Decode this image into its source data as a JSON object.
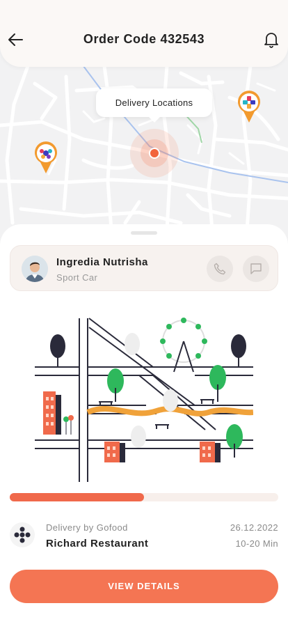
{
  "header": {
    "title": "Order Code 432543",
    "back_icon": "arrow-left-icon",
    "notification_icon": "bell-icon"
  },
  "map": {
    "tooltip": "Delivery Locations"
  },
  "driver": {
    "name": "Ingredia Nutrisha",
    "vehicle": "Sport Car",
    "call_icon": "phone-icon",
    "chat_icon": "chat-icon"
  },
  "delivery": {
    "progress_fraction": 0.5,
    "provider": "Delivery by Gofood",
    "restaurant": "Richard Restaurant",
    "date": "26.12.2022",
    "eta": "10-20 Min"
  },
  "actions": {
    "view_details": "VIEW DETAILS"
  },
  "colors": {
    "accent": "#f47553",
    "progress_track": "#f7efeb",
    "pin": "#f29a2e"
  }
}
